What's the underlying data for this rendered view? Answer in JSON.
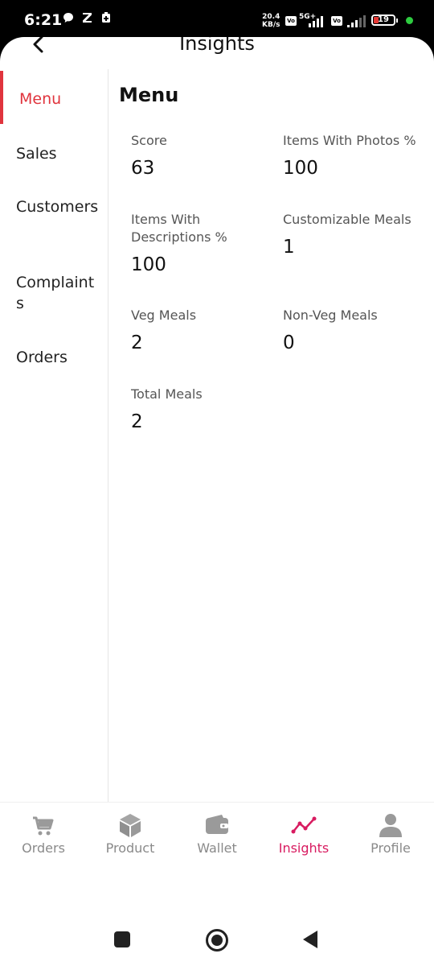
{
  "status_bar": {
    "time": "6:21",
    "notif_icons": [
      "chat-bubble-icon",
      "z-app-icon",
      "shield-plus-icon"
    ],
    "speed_value": "20.4",
    "speed_unit": "KB/s",
    "network": "5G+",
    "battery": "19"
  },
  "header": {
    "title": "Insights",
    "back_icon": "chevron-left-icon"
  },
  "sidebar": {
    "items": [
      {
        "label": "Menu",
        "active": true
      },
      {
        "label": "Sales",
        "active": false
      },
      {
        "label": "Customers",
        "active": false
      },
      {
        "label": "Complaints",
        "active": false
      },
      {
        "label": "Orders",
        "active": false
      }
    ]
  },
  "content": {
    "title": "Menu",
    "stats": [
      {
        "label": "Score",
        "value": "63"
      },
      {
        "label": "Items With Photos %",
        "value": "100"
      },
      {
        "label": "Items With Descriptions %",
        "value": "100"
      },
      {
        "label": "Customizable Meals",
        "value": "1"
      },
      {
        "label": "Veg Meals",
        "value": "2"
      },
      {
        "label": "Non-Veg Meals",
        "value": "0"
      },
      {
        "label": "Total Meals",
        "value": "2"
      }
    ]
  },
  "bottom_nav": {
    "items": [
      {
        "label": "Orders",
        "icon": "cart-icon",
        "active": false
      },
      {
        "label": "Product",
        "icon": "cube-icon",
        "active": false
      },
      {
        "label": "Wallet",
        "icon": "wallet-icon",
        "active": false
      },
      {
        "label": "Insights",
        "icon": "trend-line-icon",
        "active": true
      },
      {
        "label": "Profile",
        "icon": "person-icon",
        "active": false
      }
    ]
  },
  "colors": {
    "accent": "#e0343d",
    "nav_active": "#d81b60",
    "nav_inactive": "#8a8a8a"
  }
}
